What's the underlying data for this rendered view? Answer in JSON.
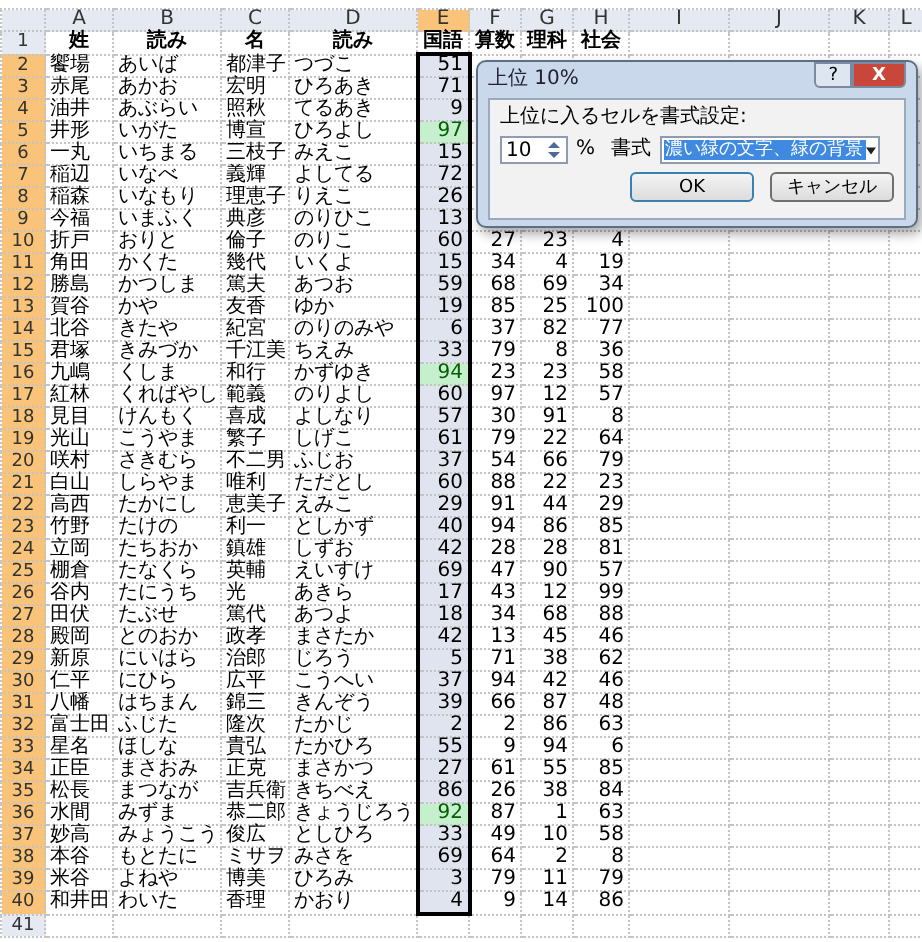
{
  "sheet": {
    "columns": [
      {
        "label": "A",
        "selected": false
      },
      {
        "label": "B",
        "selected": false
      },
      {
        "label": "C",
        "selected": false
      },
      {
        "label": "D",
        "selected": false
      },
      {
        "label": "E",
        "selected": true
      },
      {
        "label": "F",
        "selected": false
      },
      {
        "label": "G",
        "selected": false
      },
      {
        "label": "H",
        "selected": false
      },
      {
        "label": "I",
        "selected": false
      },
      {
        "label": "J",
        "selected": false
      },
      {
        "label": "K",
        "selected": false
      },
      {
        "label": "L",
        "selected": false
      }
    ],
    "rows": [
      {
        "header": "1",
        "selected": false,
        "cells": [
          "姓",
          "読み",
          "名",
          "読み",
          "国語",
          "算数",
          "理科",
          "社会"
        ]
      },
      {
        "header": "2",
        "selected": true,
        "highlighted": false,
        "cells": [
          "饗場",
          "あいば",
          "都津子",
          "つづこ",
          "51"
        ]
      },
      {
        "header": "3",
        "selected": true,
        "highlighted": false,
        "cells": [
          "赤尾",
          "あかお",
          "宏明",
          "ひろあき",
          "71"
        ]
      },
      {
        "header": "4",
        "selected": true,
        "highlighted": false,
        "cells": [
          "油井",
          "あぶらい",
          "照秋",
          "てるあき",
          "9"
        ]
      },
      {
        "header": "5",
        "selected": true,
        "highlighted": true,
        "cells": [
          "井形",
          "いがた",
          "博宣",
          "ひろよし",
          "97"
        ]
      },
      {
        "header": "6",
        "selected": true,
        "highlighted": false,
        "cells": [
          "一丸",
          "いちまる",
          "三枝子",
          "みえこ",
          "15"
        ]
      },
      {
        "header": "7",
        "selected": true,
        "highlighted": false,
        "cells": [
          "稲辺",
          "いなべ",
          "義輝",
          "よしてる",
          "72"
        ]
      },
      {
        "header": "8",
        "selected": true,
        "highlighted": false,
        "cells": [
          "稲森",
          "いなもり",
          "理恵子",
          "りえこ",
          "26"
        ]
      },
      {
        "header": "9",
        "selected": true,
        "highlighted": false,
        "cells": [
          "今福",
          "いまふく",
          "典彦",
          "のりひこ",
          "13"
        ]
      },
      {
        "header": "10",
        "selected": true,
        "highlighted": false,
        "cells": [
          "折戸",
          "おりと",
          "倫子",
          "のりこ",
          "60",
          "27",
          "23",
          "4"
        ]
      },
      {
        "header": "11",
        "selected": true,
        "highlighted": false,
        "cells": [
          "角田",
          "かくた",
          "幾代",
          "いくよ",
          "15",
          "34",
          "4",
          "19"
        ]
      },
      {
        "header": "12",
        "selected": true,
        "highlighted": false,
        "cells": [
          "勝島",
          "かつしま",
          "篤夫",
          "あつお",
          "59",
          "68",
          "69",
          "34"
        ]
      },
      {
        "header": "13",
        "selected": true,
        "highlighted": false,
        "cells": [
          "賀谷",
          "かや",
          "友香",
          "ゆか",
          "19",
          "85",
          "25",
          "100"
        ]
      },
      {
        "header": "14",
        "selected": true,
        "highlighted": false,
        "cells": [
          "北谷",
          "きたや",
          "紀宮",
          "のりのみや",
          "6",
          "37",
          "82",
          "77"
        ]
      },
      {
        "header": "15",
        "selected": true,
        "highlighted": false,
        "cells": [
          "君塚",
          "きみづか",
          "千江美",
          "ちえみ",
          "33",
          "79",
          "8",
          "36"
        ]
      },
      {
        "header": "16",
        "selected": true,
        "highlighted": true,
        "cells": [
          "九嶋",
          "くしま",
          "和行",
          "かずゆき",
          "94",
          "23",
          "23",
          "58"
        ]
      },
      {
        "header": "17",
        "selected": true,
        "highlighted": false,
        "cells": [
          "紅林",
          "くればやし",
          "範義",
          "のりよし",
          "60",
          "97",
          "12",
          "57"
        ]
      },
      {
        "header": "18",
        "selected": true,
        "highlighted": false,
        "cells": [
          "見目",
          "けんもく",
          "喜成",
          "よしなり",
          "57",
          "30",
          "91",
          "8"
        ]
      },
      {
        "header": "19",
        "selected": true,
        "highlighted": false,
        "cells": [
          "光山",
          "こうやま",
          "繁子",
          "しげこ",
          "61",
          "79",
          "22",
          "64"
        ]
      },
      {
        "header": "20",
        "selected": true,
        "highlighted": false,
        "cells": [
          "咲村",
          "さきむら",
          "不二男",
          "ふじお",
          "37",
          "54",
          "66",
          "79"
        ]
      },
      {
        "header": "21",
        "selected": true,
        "highlighted": false,
        "cells": [
          "白山",
          "しらやま",
          "唯利",
          "ただとし",
          "60",
          "88",
          "22",
          "23"
        ]
      },
      {
        "header": "22",
        "selected": true,
        "highlighted": false,
        "cells": [
          "高西",
          "たかにし",
          "恵美子",
          "えみこ",
          "29",
          "91",
          "44",
          "29"
        ]
      },
      {
        "header": "23",
        "selected": true,
        "highlighted": false,
        "cells": [
          "竹野",
          "たけの",
          "利一",
          "としかず",
          "40",
          "94",
          "86",
          "85"
        ]
      },
      {
        "header": "24",
        "selected": true,
        "highlighted": false,
        "cells": [
          "立岡",
          "たちおか",
          "鎮雄",
          "しずお",
          "42",
          "28",
          "28",
          "81"
        ]
      },
      {
        "header": "25",
        "selected": true,
        "highlighted": false,
        "cells": [
          "棚倉",
          "たなくら",
          "英輔",
          "えいすけ",
          "69",
          "47",
          "90",
          "57"
        ]
      },
      {
        "header": "26",
        "selected": true,
        "highlighted": false,
        "cells": [
          "谷内",
          "たにうち",
          "光",
          "あきら",
          "17",
          "43",
          "12",
          "99"
        ]
      },
      {
        "header": "27",
        "selected": true,
        "highlighted": false,
        "cells": [
          "田伏",
          "たぶせ",
          "篤代",
          "あつよ",
          "18",
          "34",
          "68",
          "88"
        ]
      },
      {
        "header": "28",
        "selected": true,
        "highlighted": false,
        "cells": [
          "殿岡",
          "とのおか",
          "政孝",
          "まさたか",
          "42",
          "13",
          "45",
          "46"
        ]
      },
      {
        "header": "29",
        "selected": true,
        "highlighted": false,
        "cells": [
          "新原",
          "にいはら",
          "治郎",
          "じろう",
          "5",
          "71",
          "38",
          "62"
        ]
      },
      {
        "header": "30",
        "selected": true,
        "highlighted": false,
        "cells": [
          "仁平",
          "にひら",
          "広平",
          "こうへい",
          "37",
          "94",
          "42",
          "46"
        ]
      },
      {
        "header": "31",
        "selected": true,
        "highlighted": false,
        "cells": [
          "八幡",
          "はちまん",
          "錦三",
          "きんぞう",
          "39",
          "66",
          "87",
          "48"
        ]
      },
      {
        "header": "32",
        "selected": true,
        "highlighted": false,
        "cells": [
          "富士田",
          "ふじた",
          "隆次",
          "たかじ",
          "2",
          "2",
          "86",
          "63"
        ]
      },
      {
        "header": "33",
        "selected": true,
        "highlighted": false,
        "cells": [
          "星名",
          "ほしな",
          "貴弘",
          "たかひろ",
          "55",
          "9",
          "94",
          "6"
        ]
      },
      {
        "header": "34",
        "selected": true,
        "highlighted": false,
        "cells": [
          "正臣",
          "まさおみ",
          "正克",
          "まさかつ",
          "27",
          "61",
          "55",
          "85"
        ]
      },
      {
        "header": "35",
        "selected": true,
        "highlighted": false,
        "cells": [
          "松長",
          "まつなが",
          "吉兵衛",
          "きちべえ",
          "86",
          "26",
          "38",
          "84"
        ]
      },
      {
        "header": "36",
        "selected": true,
        "highlighted": true,
        "cells": [
          "水間",
          "みずま",
          "恭二郎",
          "きょうじろう",
          "92",
          "87",
          "1",
          "63"
        ]
      },
      {
        "header": "37",
        "selected": true,
        "highlighted": false,
        "cells": [
          "妙高",
          "みょうこう",
          "俊広",
          "としひろ",
          "33",
          "49",
          "10",
          "58"
        ]
      },
      {
        "header": "38",
        "selected": true,
        "highlighted": false,
        "cells": [
          "本谷",
          "もとたに",
          "ミサヲ",
          "みさを",
          "69",
          "64",
          "2",
          "8"
        ]
      },
      {
        "header": "39",
        "selected": true,
        "highlighted": false,
        "cells": [
          "米谷",
          "よねや",
          "博美",
          "ひろみ",
          "3",
          "79",
          "11",
          "79"
        ]
      },
      {
        "header": "40",
        "selected": true,
        "highlighted": false,
        "cells": [
          "和井田",
          "わいた",
          "香理",
          "かおり",
          "4",
          "9",
          "14",
          "86"
        ]
      },
      {
        "header": "41",
        "selected": false
      }
    ]
  },
  "dialog": {
    "title": "上位 10%",
    "title_buttons": [
      "?",
      "X"
    ],
    "prompt": "上位に入るセルを書式設定:",
    "rank": "10",
    "unit": "%",
    "format_label": "書式",
    "format": "濃い緑の文字、緑の背景",
    "buttons": [
      "OK",
      "キャンセル"
    ]
  }
}
